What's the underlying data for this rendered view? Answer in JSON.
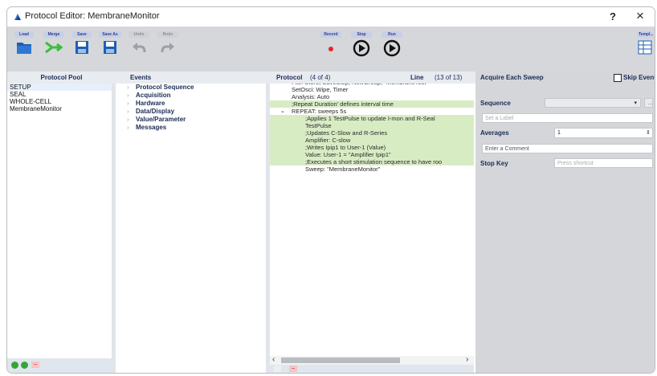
{
  "window": {
    "title": "Protocol Editor: MembraneMonitor",
    "help": "?",
    "close": "×"
  },
  "toolbar": {
    "load": "Load",
    "merge": "Merge",
    "save": "Save",
    "save_as": "Save As",
    "undo": "Undo",
    "redo": "Redo",
    "record": "Record",
    "stop": "Stop",
    "run": "Run",
    "templates": "Templ..."
  },
  "headers": {
    "pool": "Protocol Pool",
    "events": "Events",
    "protocol": "Protocol",
    "protocol_count": "(4 of 4)",
    "line": "Line",
    "line_count": "(13 of 13)",
    "acquire": "Acquire Each Sweep",
    "skip": "Skip Events"
  },
  "pool": [
    "SETUP",
    "SEAL",
    "WHOLE-CELL",
    "MembraneMonitor"
  ],
  "events": [
    "Protocol Sequence",
    "Acquisition",
    "Hardware",
    "Data/Display",
    "Value/Parameter",
    "Messages"
  ],
  "protocol_lines": [
    {
      "text": "File: Store, SaveStop, NewGroup, \"MembraneTest\"",
      "indent": 0,
      "hl": false
    },
    {
      "text": "SetOsci: Wipe, Timer",
      "indent": 0,
      "hl": false
    },
    {
      "text": "Analysis: Auto",
      "indent": 0,
      "hl": false
    },
    {
      "text": ";Repeat Duration' defines interval time",
      "indent": 0,
      "hl": true
    },
    {
      "text": "REPEAT: sweeps 5s",
      "indent": 0,
      "hl": false,
      "fold": "⌄"
    },
    {
      "text": ";Applies 1 TestPulse to update I-mon and R-Seal",
      "indent": 1,
      "hl": true
    },
    {
      "text": "TestPulse",
      "indent": 1,
      "hl": true
    },
    {
      "text": ";Updates C-Slow and R-Series",
      "indent": 1,
      "hl": true
    },
    {
      "text": "Amplifier: C-slow",
      "indent": 1,
      "hl": true
    },
    {
      "text": ";Writes Ipip1 to User-1 (Value)",
      "indent": 1,
      "hl": true
    },
    {
      "text": "Value: User-1 = \"Amplifier Ipip1\"",
      "indent": 1,
      "hl": true
    },
    {
      "text": ";Executes a short stimulation sequence to have roo",
      "indent": 1,
      "hl": true
    },
    {
      "text": "Sweep: \"MembraneMonitor\"",
      "indent": 1,
      "hl": false
    }
  ],
  "right": {
    "sequence_label": "Sequence",
    "label_placeholder": "Set a Label",
    "averages_label": "Averages",
    "averages_value": "1",
    "comment_placeholder": "Enter a Comment",
    "stopkey_label": "Stop Key",
    "stopkey_placeholder": "Press shortcut"
  },
  "scroll": {
    "left": "‹",
    "right": "›"
  },
  "colors": {
    "highlight": "#d8ecc4",
    "toolbar": "#d5d7da",
    "panel": "#d4d6d9"
  }
}
